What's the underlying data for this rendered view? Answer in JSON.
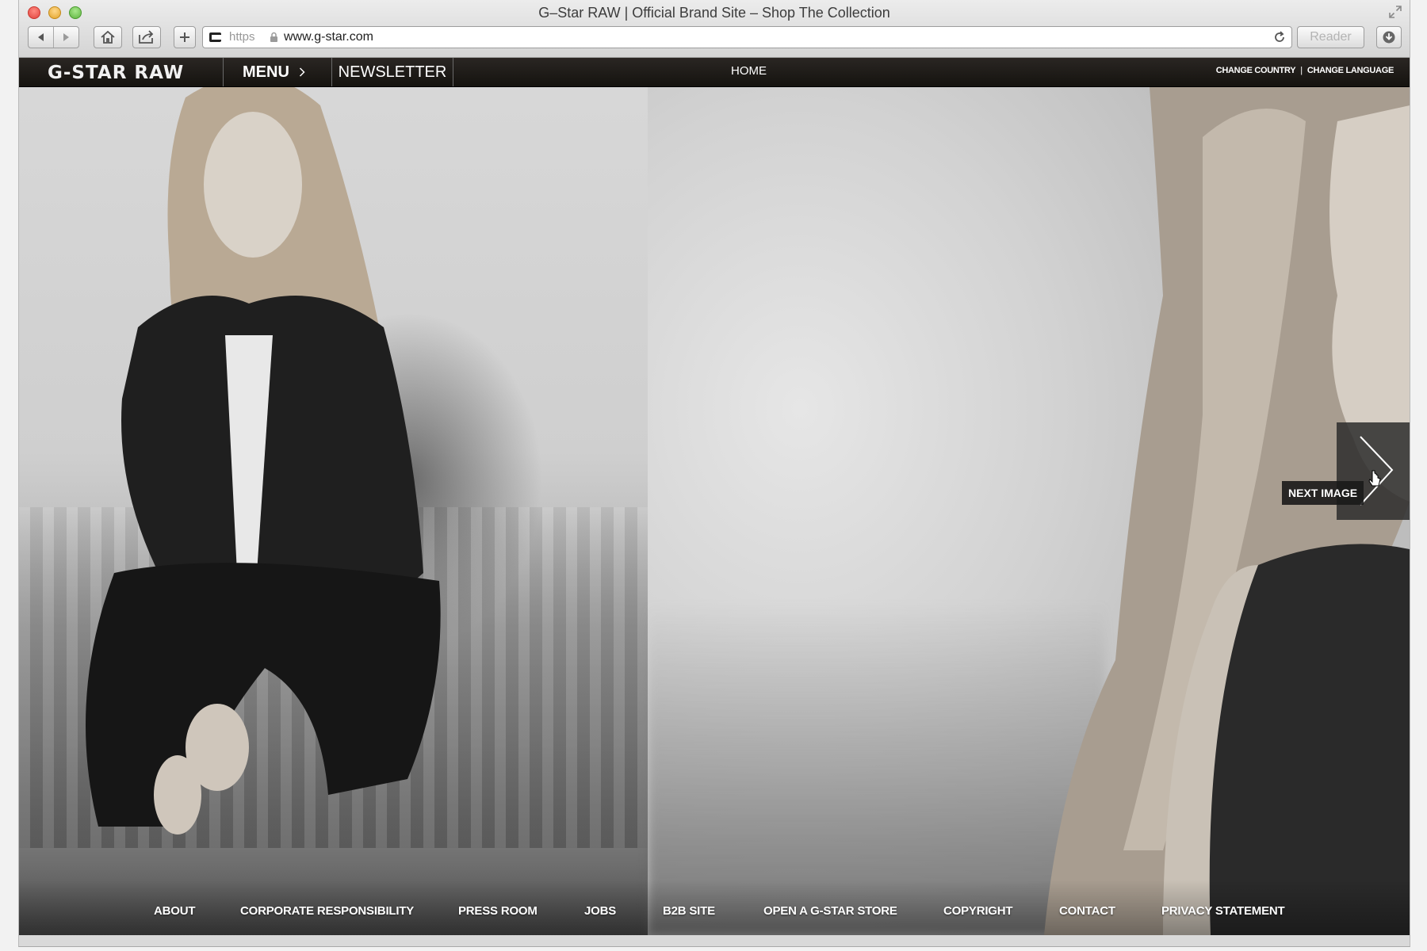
{
  "browser": {
    "window_title": "G–Star RAW | Official Brand Site – Shop The Collection",
    "url_scheme": "https",
    "url": "www.g-star.com",
    "reader_label": "Reader"
  },
  "site": {
    "logo_text": "G-STAR RAW",
    "menu_label": "MENU",
    "newsletter_label": "NEWSLETTER",
    "home_label": "HOME",
    "change_country_label": "CHANGE COUNTRY",
    "change_language_label": "CHANGE LANGUAGE",
    "next_image_label": "NEXT IMAGE"
  },
  "footer": {
    "links": [
      "ABOUT",
      "CORPORATE RESPONSIBILITY",
      "PRESS ROOM",
      "JOBS",
      "B2B SITE",
      "OPEN A G-STAR STORE",
      "COPYRIGHT",
      "CONTACT",
      "PRIVACY STATEMENT"
    ]
  }
}
